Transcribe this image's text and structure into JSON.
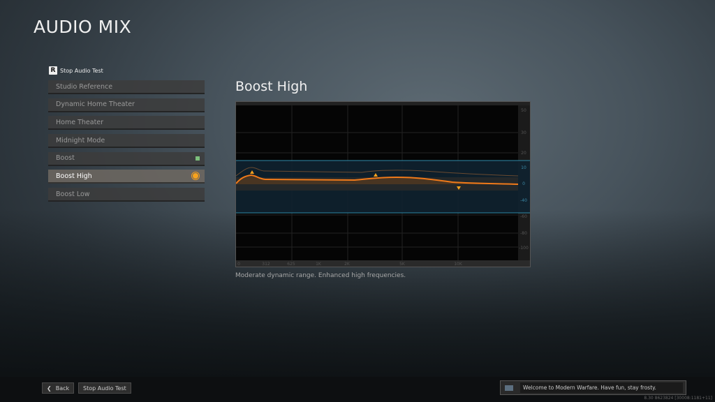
{
  "title": "AUDIO MIX",
  "hint": {
    "key": "R",
    "label": "Stop Audio Test"
  },
  "presets": [
    {
      "label": "Studio Reference"
    },
    {
      "label": "Dynamic Home Theater"
    },
    {
      "label": "Home Theater"
    },
    {
      "label": "Midnight Mode"
    },
    {
      "label": "Boost",
      "indicator": "applied"
    },
    {
      "label": "Boost High",
      "selected": true
    },
    {
      "label": "Boost Low"
    }
  ],
  "panel": {
    "title": "Boost High",
    "description": "Moderate dynamic range. Enhanced high frequencies."
  },
  "eq_graph": {
    "y_labels": [
      "50",
      "30",
      "20",
      "10",
      "0",
      "-40",
      "-60",
      "-80",
      "-100"
    ],
    "x_labels": [
      "0",
      "312",
      "625",
      "1K",
      "2K",
      "5K",
      "10K"
    ],
    "colors": {
      "curve": "#f07a1a",
      "band": "#1a4a60",
      "band_edge": "#2f89a8"
    }
  },
  "footer": {
    "back": "Back",
    "stop": "Stop Audio Test",
    "chat": "Welcome to Modern Warfare. Have fun, stay frosty.",
    "version": "8.30 8623824 [30008:1181+11]"
  },
  "colors": {
    "accent": "#f7a21e",
    "applied": "#7cbf7c"
  }
}
